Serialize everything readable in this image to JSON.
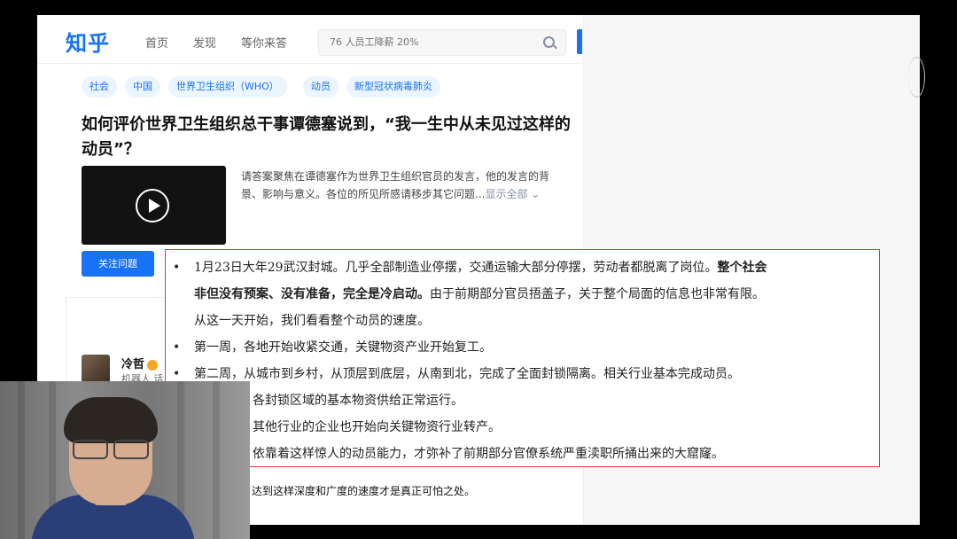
{
  "header": {
    "logo": "知乎",
    "nav": [
      "首页",
      "发现",
      "等你来答"
    ],
    "search_placeholder": "76 人员工降薪 20%"
  },
  "tags": [
    "社会",
    "中国",
    "世界卫生组织（WHO）",
    "动员",
    "新型冠状病毒肺炎"
  ],
  "question": {
    "title": "如何评价世界卫生组织总干事谭德塞说到，“我一生中从未见过这样的动员”？",
    "desc_line1": "请答案聚焦在谭德塞作为世界卫生组织官员的发言，他的发言的背",
    "desc_line2": "景、影响与意义。各位的所见所感请移步其它问题...",
    "show_all": "显示全部",
    "follow_button": "关注问题"
  },
  "answer": {
    "author": "冷哲",
    "author_sub": "机器人 话",
    "bottom_text": "达到这样深度和广度的速度才是真正可怕之处。"
  },
  "overlay": {
    "bullet": "•",
    "lines": [
      {
        "pre": "1月23日大年29武汉封城。几乎全部制造业停摆，交通运输大部分停摆，劳动者都脱离了岗位。",
        "bold": "整个社会"
      },
      {
        "bold": "非但没有预案、没有准备，完全是冷启动。",
        "post": "由于前期部分官员捂盖子，关于整个局面的信息也非常有限。"
      },
      {
        "text": "从这一天开始，我们看看整个动员的速度。"
      },
      {
        "text": "第一周，各地开始收紧交通，关键物资产业开始复工。"
      },
      {
        "text": "第二周，从城市到乡村，从顶层到底层，从南到北，完成了全面封锁隔离。相关行业基本完成动员。"
      },
      {
        "text": "各封锁区域的基本物资供给正常运行。"
      },
      {
        "text": "其他行业的企业也开始向关键物资行业转产。"
      },
      {
        "text": "依靠着这样惊人的动员能力，才弥补了前期部分官僚系统严重渎职所捅出来的大窟窿。"
      }
    ]
  }
}
